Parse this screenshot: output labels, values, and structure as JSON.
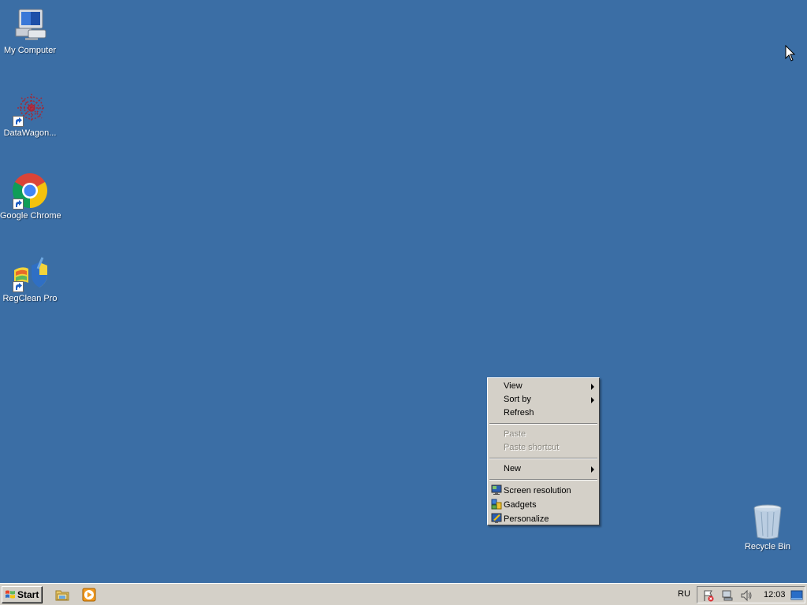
{
  "desktop": {
    "background": "#3b6ea5",
    "icons": [
      {
        "label": "My Computer",
        "icon": "computer-icon"
      },
      {
        "label": "DataWagon...",
        "icon": "datawagon-icon"
      },
      {
        "label": "Google Chrome",
        "icon": "chrome-icon"
      },
      {
        "label": "RegClean Pro",
        "icon": "regclean-icon"
      },
      {
        "label": "Recycle Bin",
        "icon": "recycle-bin-icon"
      }
    ]
  },
  "context_menu": {
    "items": [
      {
        "label": "View",
        "submenu": true,
        "enabled": true
      },
      {
        "label": "Sort by",
        "submenu": true,
        "enabled": true
      },
      {
        "label": "Refresh",
        "submenu": false,
        "enabled": true
      },
      {
        "label": "Paste",
        "submenu": false,
        "enabled": false
      },
      {
        "label": "Paste shortcut",
        "submenu": false,
        "enabled": false
      },
      {
        "label": "New",
        "submenu": true,
        "enabled": true
      },
      {
        "label": "Screen resolution",
        "icon": "display-icon",
        "enabled": true
      },
      {
        "label": "Gadgets",
        "icon": "gadgets-icon",
        "enabled": true
      },
      {
        "label": "Personalize",
        "icon": "personalize-icon",
        "enabled": true
      }
    ]
  },
  "taskbar": {
    "start_label": "Start",
    "quick_launch": [
      "explorer-icon",
      "media-player-icon"
    ],
    "language": "RU",
    "tray_icons": [
      "action-center-flag-icon",
      "network-icon",
      "volume-icon",
      "show-desktop-icon"
    ],
    "clock": "12:03"
  }
}
